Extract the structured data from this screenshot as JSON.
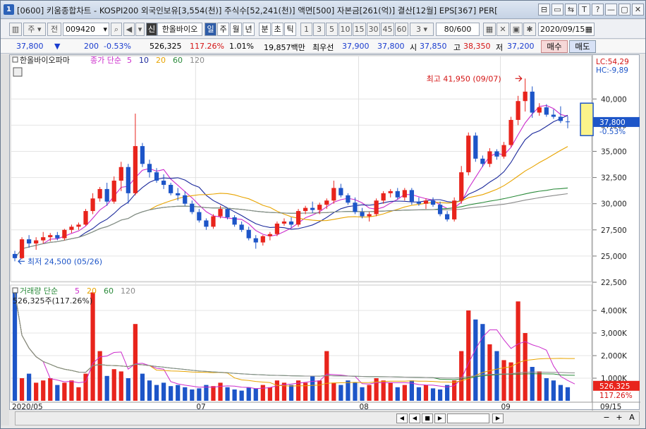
{
  "window": {
    "icon_label": "1",
    "title": "[0600] 키움종합차트 - KOSPI200 외국인보유[3,554(천)] 주식수[52,241(천)] 액면[500] 자본금[261(억)] 결산[12월] EPS[367] PER[",
    "controls": [
      "⊟",
      "▭",
      "⇆",
      "T",
      "?",
      "—",
      "▢",
      "✕"
    ]
  },
  "toolbar": {
    "menu_label": "주",
    "prev_label": "전",
    "code": "009420",
    "stock_name": "한올바이오",
    "name_prefix": "신",
    "periods": [
      "일",
      "주",
      "월",
      "년",
      "분",
      "초",
      "틱"
    ],
    "numbers": [
      "1",
      "3",
      "5",
      "10",
      "15",
      "30",
      "45",
      "60",
      "3"
    ],
    "count": "80",
    "count_total": "/600",
    "date": "2020/09/15"
  },
  "quote": {
    "price": "37,800",
    "price_arrow": "▼",
    "change": "200",
    "change_pct": "-0.53%",
    "volume": "526,325",
    "volume_ratio": "117.26%",
    "turnover": "1.01%",
    "amount": "19,857백만",
    "priority_label": "최우선",
    "bid1": "37,900",
    "bid2": "37,800",
    "open_label": "시",
    "open": "37,850",
    "high_label": "고",
    "high": "38,350",
    "low_label": "저",
    "low": "37,200",
    "buy_label": "매수",
    "sell_label": "매도"
  },
  "chart_data": {
    "type": "candlestick",
    "stock": "한올바이오파마",
    "legend": {
      "price_title": "종가 단순",
      "ma_periods": [
        "5",
        "10",
        "20",
        "60",
        "120"
      ],
      "volume_title": "거래량 단순",
      "volume_ma_periods": [
        "5",
        "20",
        "60",
        "120"
      ],
      "volume_summary": "526,325주(117.26%)"
    },
    "annotations": {
      "high": "최고 41,950 (09/07)",
      "low": "최저 24,500 (05/26)",
      "lc": "LC:54,29",
      "hc": "HC:-9,89",
      "current_price": "37,800",
      "current_pct": "-0.53%",
      "current_volume": "526,325",
      "current_volume_pct": "117.26%"
    },
    "price_axis": {
      "min": 22500,
      "max": 41500,
      "ticks": [
        40000,
        37500,
        35000,
        32500,
        30000,
        27500,
        25000,
        22500
      ],
      "tick_labels": [
        "40,000",
        "37,500",
        "35,000",
        "32,500",
        "30,000",
        "27,500",
        "25,000",
        "22,500"
      ]
    },
    "volume_axis": {
      "max": 5000,
      "ticks": [
        4000,
        3000,
        2000,
        1000
      ],
      "tick_labels": [
        "4,000K",
        "3,000K",
        "2,000K",
        "1,000K"
      ]
    },
    "x_labels": [
      {
        "label": "2020/05",
        "index": 0
      },
      {
        "label": "07",
        "index": 26
      },
      {
        "label": "08",
        "index": 49
      },
      {
        "label": "09",
        "index": 69
      },
      {
        "label": "09/15",
        "index": 79
      }
    ],
    "candles": [
      [
        25200,
        25500,
        24500,
        24800
      ],
      [
        24800,
        26800,
        24700,
        26600
      ],
      [
        26600,
        27000,
        25800,
        26200
      ],
      [
        26200,
        26800,
        25600,
        26500
      ],
      [
        26500,
        27300,
        26200,
        26800
      ],
      [
        26800,
        27200,
        26400,
        27000
      ],
      [
        27000,
        27300,
        26500,
        26700
      ],
      [
        26700,
        27600,
        26500,
        27500
      ],
      [
        27500,
        28000,
        27200,
        27800
      ],
      [
        27800,
        28200,
        27500,
        28000
      ],
      [
        28000,
        29500,
        27900,
        29300
      ],
      [
        29300,
        31000,
        29000,
        30500
      ],
      [
        30500,
        31600,
        30200,
        31400
      ],
      [
        31400,
        32000,
        29800,
        30200
      ],
      [
        30200,
        32600,
        30000,
        32200
      ],
      [
        32200,
        34000,
        31200,
        33500
      ],
      [
        33500,
        33800,
        30000,
        31000
      ],
      [
        31000,
        38600,
        30800,
        35500
      ],
      [
        35500,
        35800,
        33500,
        33800
      ],
      [
        33800,
        34200,
        32500,
        33000
      ],
      [
        33000,
        33400,
        32000,
        32200
      ],
      [
        32200,
        32800,
        31400,
        31800
      ],
      [
        31800,
        32000,
        30800,
        31000
      ],
      [
        31000,
        31500,
        30300,
        30800
      ],
      [
        30800,
        31200,
        29800,
        30000
      ],
      [
        30000,
        30300,
        29000,
        29200
      ],
      [
        29200,
        29500,
        28200,
        28400
      ],
      [
        28400,
        28600,
        27500,
        27800
      ],
      [
        27800,
        29000,
        27600,
        28800
      ],
      [
        28800,
        29800,
        28600,
        29500
      ],
      [
        29500,
        29600,
        28500,
        28700
      ],
      [
        28700,
        28900,
        27800,
        28000
      ],
      [
        28000,
        28300,
        27300,
        27500
      ],
      [
        27500,
        27800,
        26500,
        26700
      ],
      [
        26700,
        27000,
        25700,
        26300
      ],
      [
        26300,
        27000,
        26000,
        26900
      ],
      [
        26900,
        27300,
        26500,
        27100
      ],
      [
        27100,
        28300,
        26900,
        28100
      ],
      [
        28100,
        28600,
        27900,
        28300
      ],
      [
        28300,
        28700,
        27700,
        28000
      ],
      [
        28000,
        29500,
        27800,
        29300
      ],
      [
        29300,
        29800,
        29000,
        29600
      ],
      [
        29600,
        30200,
        29100,
        29400
      ],
      [
        29400,
        30100,
        29000,
        29900
      ],
      [
        29900,
        30500,
        29500,
        30300
      ],
      [
        30300,
        32200,
        30000,
        31500
      ],
      [
        31500,
        31900,
        30600,
        30800
      ],
      [
        30800,
        31000,
        29900,
        30100
      ],
      [
        30100,
        30600,
        29000,
        29200
      ],
      [
        29200,
        29600,
        28600,
        28800
      ],
      [
        28800,
        29200,
        28300,
        29000
      ],
      [
        29000,
        30500,
        28800,
        30300
      ],
      [
        30300,
        31200,
        30000,
        31000
      ],
      [
        31000,
        31400,
        30600,
        31200
      ],
      [
        31200,
        31500,
        30400,
        30600
      ],
      [
        30600,
        31500,
        30300,
        31300
      ],
      [
        31300,
        31500,
        29900,
        30200
      ],
      [
        30200,
        30600,
        29800,
        30000
      ],
      [
        30000,
        30500,
        29500,
        30300
      ],
      [
        30300,
        30600,
        29700,
        29900
      ],
      [
        29900,
        30200,
        28800,
        29000
      ],
      [
        29000,
        29300,
        28300,
        28500
      ],
      [
        28500,
        30600,
        28300,
        30300
      ],
      [
        30300,
        33600,
        30000,
        33000
      ],
      [
        33000,
        36800,
        32700,
        36500
      ],
      [
        36500,
        36800,
        34000,
        34300
      ],
      [
        34300,
        34600,
        33500,
        33800
      ],
      [
        33800,
        35300,
        33500,
        35000
      ],
      [
        35000,
        35200,
        34200,
        34500
      ],
      [
        34500,
        35900,
        34300,
        35600
      ],
      [
        35600,
        38300,
        35400,
        38000
      ],
      [
        38000,
        40300,
        37500,
        39800
      ],
      [
        39800,
        41950,
        38800,
        40700
      ],
      [
        40700,
        41200,
        38200,
        38700
      ],
      [
        38700,
        39600,
        38400,
        39200
      ],
      [
        39200,
        39500,
        38300,
        38500
      ],
      [
        38500,
        39000,
        38100,
        38300
      ],
      [
        38300,
        39300,
        37700,
        37900
      ],
      [
        37850,
        38350,
        37200,
        37800
      ]
    ],
    "volumes": [
      4800,
      1000,
      1200,
      800,
      900,
      1000,
      700,
      800,
      900,
      600,
      1200,
      4800,
      2200,
      1100,
      1400,
      1300,
      1000,
      3400,
      1200,
      900,
      700,
      800,
      650,
      700,
      600,
      500,
      550,
      700,
      650,
      800,
      600,
      500,
      450,
      600,
      550,
      700,
      600,
      900,
      800,
      700,
      900,
      800,
      1100,
      900,
      2200,
      800,
      700,
      900,
      800,
      600,
      700,
      1000,
      900,
      800,
      600,
      700,
      900,
      600,
      700,
      550,
      500,
      700,
      900,
      2200,
      4000,
      3600,
      3400,
      2500,
      2200,
      1800,
      1700,
      4400,
      3000,
      1500,
      1300,
      1000,
      900,
      700,
      600,
      526
    ]
  },
  "scrollbar": {
    "buttons": [
      "◀",
      "◀",
      "■",
      "▶",
      "▶"
    ]
  }
}
